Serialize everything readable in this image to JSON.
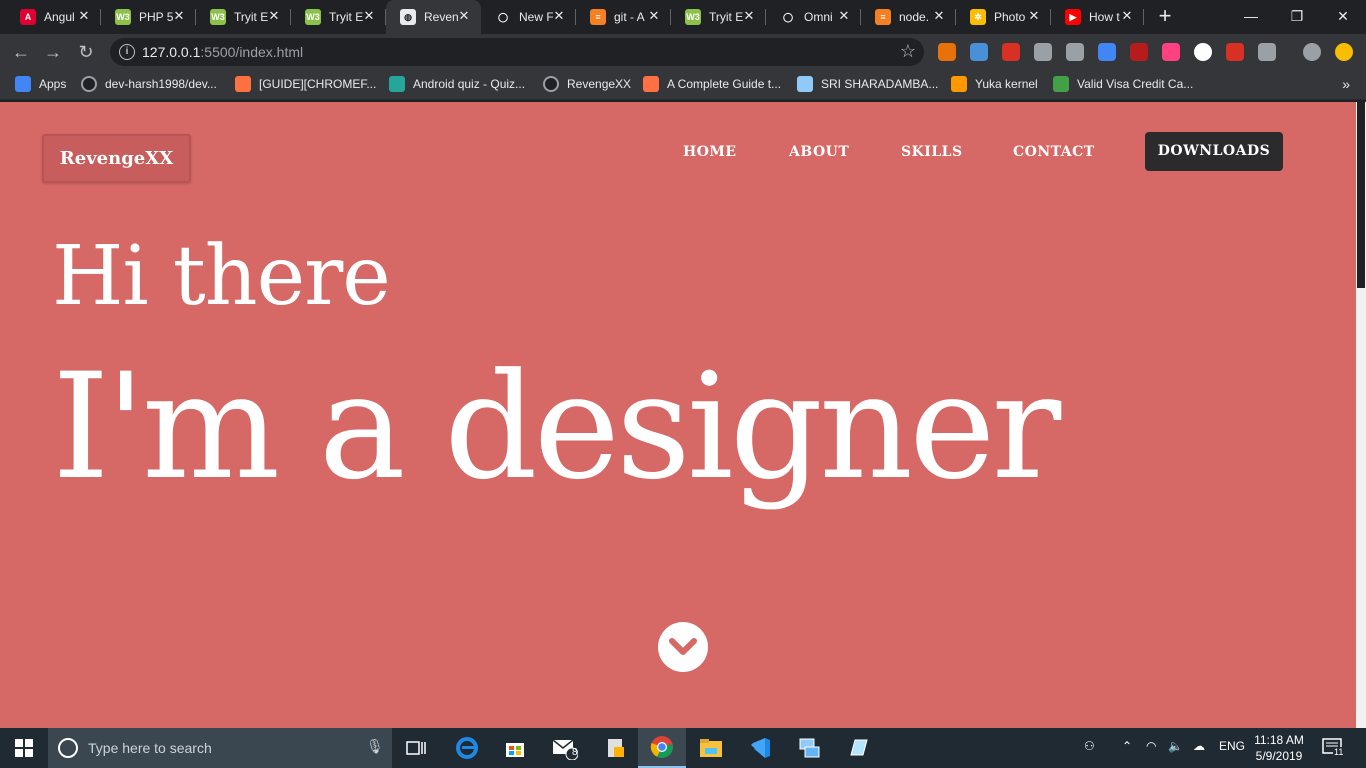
{
  "browser": {
    "tabs": [
      {
        "title": "Angul",
        "color": "#dd0031",
        "glyph": "A",
        "active": false
      },
      {
        "title": "PHP 5",
        "color": "#8bc34a",
        "glyph": "W3",
        "active": false
      },
      {
        "title": "Tryit E",
        "color": "#8bc34a",
        "glyph": "W3",
        "active": false
      },
      {
        "title": "Tryit E",
        "color": "#8bc34a",
        "glyph": "W3",
        "active": false
      },
      {
        "title": "Reven",
        "color": "#e8eaed",
        "glyph": "◍",
        "active": true
      },
      {
        "title": "New F",
        "color": "#202124",
        "glyph": "◯",
        "active": false
      },
      {
        "title": "git - A",
        "color": "#f48024",
        "glyph": "≡",
        "active": false
      },
      {
        "title": "Tryit E",
        "color": "#8bc34a",
        "glyph": "W3",
        "active": false
      },
      {
        "title": "Omni",
        "color": "#202124",
        "glyph": "◯",
        "active": false
      },
      {
        "title": "node.",
        "color": "#f48024",
        "glyph": "≡",
        "active": false
      },
      {
        "title": "Photo",
        "color": "#fbbc04",
        "glyph": "✲",
        "active": false
      },
      {
        "title": "How t",
        "color": "#ff0000",
        "glyph": "▶",
        "active": false
      }
    ],
    "close_glyph": "✕",
    "new_tab_glyph": "+",
    "window_controls": {
      "minimize": "—",
      "restore": "❐",
      "close": "✕"
    },
    "toolbar": {
      "back": "←",
      "forward": "→",
      "reload": "↻",
      "info": "i",
      "url_host": "127.0.0.1",
      "url_path": ":5500/index.html",
      "star": "☆"
    },
    "extensions": [
      "#e8710a",
      "#4a90d9",
      "#d93025",
      "#9aa0a6",
      "#9aa0a6",
      "#4285f4",
      "#b71c1c",
      "#ff4081",
      "#ffffff",
      "#d93025",
      "#9aa0a6",
      "#9aa0a6",
      "#fbbc04"
    ],
    "bookmarks": [
      {
        "label": "Apps",
        "color": "#4285f4"
      },
      {
        "label": "dev-harsh1998/dev...",
        "color": "#202124"
      },
      {
        "label": "[GUIDE][CHROMEF...",
        "color": "#ff7043"
      },
      {
        "label": "Android quiz - Quiz...",
        "color": "#26a69a"
      },
      {
        "label": "RevengeXX",
        "color": "#202124"
      },
      {
        "label": "A Complete Guide t...",
        "color": "#ff7043"
      },
      {
        "label": "SRI SHARADAMBA...",
        "color": "#90caf9"
      },
      {
        "label": "Yuka kernel",
        "color": "#ff9800"
      },
      {
        "label": "Valid Visa Credit Ca...",
        "color": "#43a047"
      }
    ],
    "bookmarks_more": "»"
  },
  "site": {
    "logo": "RevengeXX",
    "nav": [
      "HOME",
      "ABOUT",
      "SKILLS",
      "CONTACT"
    ],
    "cta": "DOWNLOADS",
    "greeting": "Hi there",
    "headline": "I'm a designer",
    "accent": "#d66866"
  },
  "taskbar": {
    "search_placeholder": "Type here to search",
    "mail_badge": "8",
    "language": "ENG",
    "time": "11:18 AM",
    "date": "5/9/2019",
    "notifications": "11"
  }
}
